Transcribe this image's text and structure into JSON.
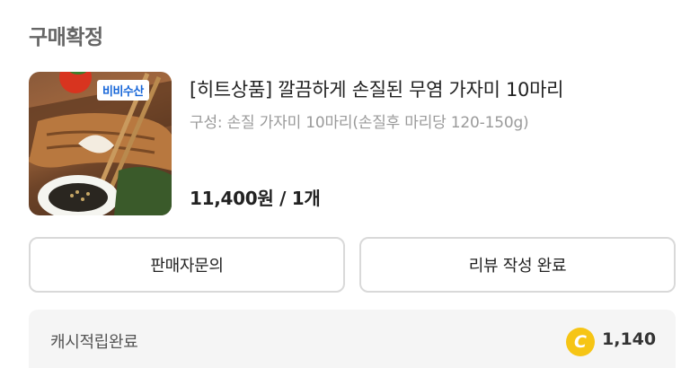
{
  "order": {
    "status": "구매확정"
  },
  "product": {
    "brand_badge": "비비수산",
    "title": "[히트상품] 깔끔하게 손질된 무염 가자미 10마리",
    "option": "구성: 손질 가자미 10마리(손질후 마리당 120-150g)",
    "price_line": "11,400원 / 1개"
  },
  "actions": {
    "inquiry_label": "판매자문의",
    "review_label": "리뷰 작성 완료"
  },
  "cashback": {
    "label": "캐시적립완료",
    "coin_symbol": "C",
    "amount": "1,140"
  },
  "colors": {
    "coin": "#f6c515",
    "brand_blue": "#1565d8"
  }
}
